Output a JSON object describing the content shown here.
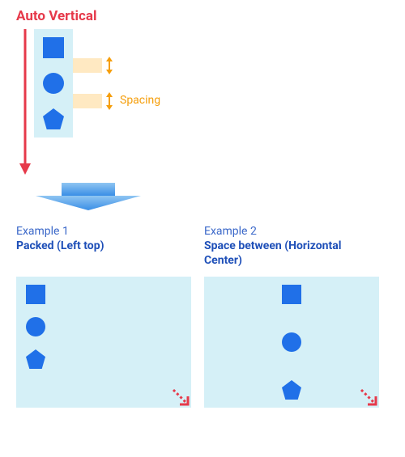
{
  "title": "Auto Vertical",
  "spacing_label": "Spacing",
  "icons": {
    "flow_arrow": "flow-arrow-down",
    "spacing_arrow": "spacing-arrow",
    "transition_arrow": "transition-arrow-down",
    "resize_arrow": "resize-handle-arrow",
    "square": "square-shape",
    "circle": "circle-shape",
    "pentagon": "pentagon-shape"
  },
  "colors": {
    "accent_red": "#e6394a",
    "shape_blue": "#2070e8",
    "panel_bg": "#d5f0f7",
    "spacing_orange": "#f59e0b",
    "spacing_fill": "#ffe9c2",
    "arrow_blue_light": "#8fc5f2",
    "arrow_blue_dark": "#3a8ee6"
  },
  "examples": [
    {
      "label": "Example 1",
      "title": "Packed (Left top)"
    },
    {
      "label": "Example 2",
      "title": "Space between (Horizontal Center)"
    }
  ]
}
